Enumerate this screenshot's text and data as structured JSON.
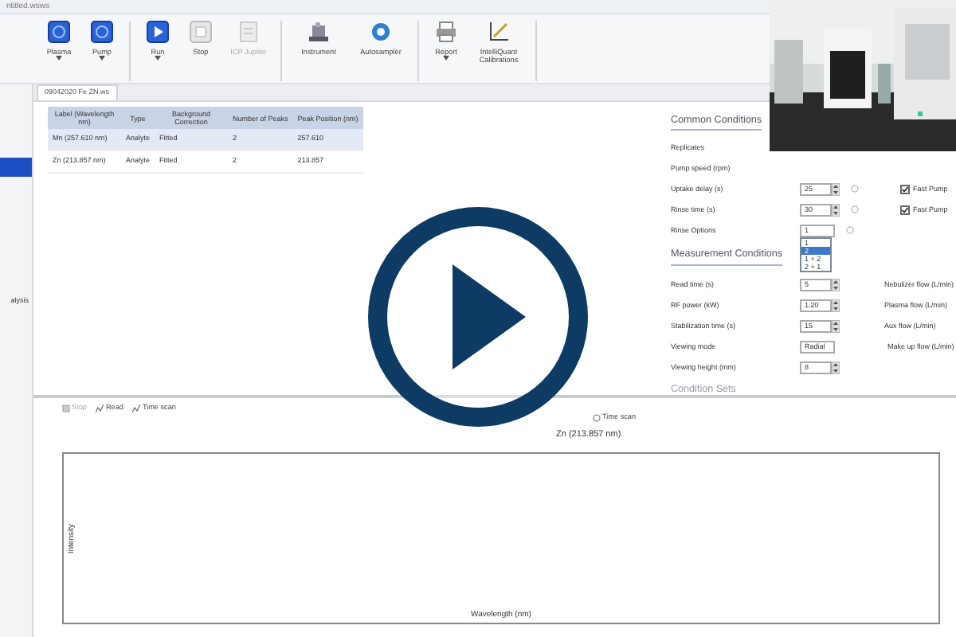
{
  "window": {
    "title": "ntitled.wsws"
  },
  "ribbon": {
    "buttons": [
      {
        "label": "Plasma",
        "kind": "blue",
        "dropdown": true
      },
      {
        "label": "Pump",
        "kind": "blue",
        "dropdown": true
      },
      {
        "label": "Run",
        "kind": "run",
        "dropdown": true
      },
      {
        "label": "Stop",
        "kind": "stop",
        "dropdown": false
      },
      {
        "label": "ICP Jupiter",
        "kind": "disabled",
        "dropdown": false
      },
      {
        "label": "Instrument",
        "kind": "instrument",
        "dropdown": false
      },
      {
        "label": "Autosampler",
        "kind": "autosampler",
        "dropdown": false
      },
      {
        "label": "Report",
        "kind": "printer",
        "dropdown": true
      },
      {
        "label": "IntelliQuant Calibrations",
        "kind": "calibration",
        "dropdown": false
      }
    ]
  },
  "document_tab": {
    "label": "09042020 Fe ZN.ws"
  },
  "sidebar": {
    "items": [
      {
        "selected": true
      },
      {
        "label": "alysis",
        "selected": false
      }
    ]
  },
  "elements_table": {
    "columns": [
      "Label (Wavelength nm)",
      "Type",
      "Background Correction",
      "Number of Peaks",
      "Peak Position (nm)"
    ],
    "rows": [
      {
        "cells": [
          "Mn (257.610 nm)",
          "Analyte",
          "Fitted",
          "2",
          "257.610"
        ],
        "selected": true
      },
      {
        "cells": [
          "Zn (213.857 nm)",
          "Analyte",
          "Fitted",
          "2",
          "213.857"
        ],
        "selected": false
      }
    ]
  },
  "common_conditions": {
    "title": "Common Conditions",
    "fields": [
      {
        "label": "Replicates",
        "kind": "plain"
      },
      {
        "label": "Pump speed (rpm)",
        "kind": "plain"
      },
      {
        "label": "Uptake delay (s)",
        "kind": "spin",
        "value": "25",
        "option": "Fast Pump",
        "checked": true
      },
      {
        "label": "Rinse time (s)",
        "kind": "spin",
        "value": "30",
        "option": "Fast Pump",
        "checked": true
      },
      {
        "label": "Rinse Options",
        "kind": "select",
        "value": "1"
      }
    ],
    "rinse_options": [
      {
        "label": "1",
        "selected": false
      },
      {
        "label": "2",
        "selected": true
      },
      {
        "label": "1 + 2",
        "selected": false
      },
      {
        "label": "2 + 1",
        "selected": false
      }
    ]
  },
  "measurement_conditions": {
    "title": "Measurement Conditions",
    "fields": [
      {
        "label": "Read time (s)",
        "kind": "spin",
        "value": "5",
        "flow": "Nebulizer flow (L/min)"
      },
      {
        "label": "RF power (kW)",
        "kind": "spin",
        "value": "1.20",
        "flow": "Plasma flow (L/min)"
      },
      {
        "label": "Stabilization time (s)",
        "kind": "spin",
        "value": "15",
        "flow": "Aux flow (L/min)"
      },
      {
        "label": "Viewing mode",
        "kind": "select",
        "value": "Radial",
        "flow": "Make up flow (L/min)"
      },
      {
        "label": "Viewing height (mm)",
        "kind": "spin",
        "value": "8"
      }
    ]
  },
  "condition_sets": {
    "title": "Condition Sets"
  },
  "scan_toolbar": {
    "buttons": [
      {
        "label": "Stop",
        "disabled": true
      },
      {
        "label": "Read",
        "disabled": false
      },
      {
        "label": "Time scan",
        "disabled": false
      }
    ]
  },
  "scan_mode": {
    "options": [
      {
        "label": "Time scan",
        "selected": false
      }
    ]
  },
  "chart": {
    "title": "Zn (213.857 nm)",
    "xlabel": "Wavelength (nm)",
    "ylabel": "Intensity"
  }
}
